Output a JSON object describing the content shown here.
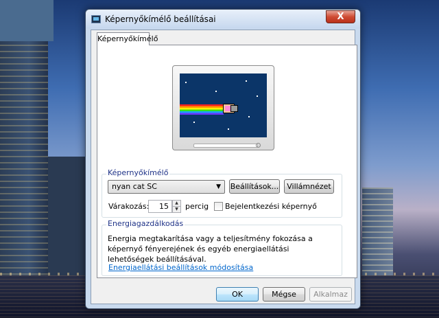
{
  "window": {
    "title": "Képernyőkímélő beállításai",
    "close_glyph": "X"
  },
  "tabs": [
    {
      "label": "Képernyőkímélő",
      "selected": true
    }
  ],
  "screensaver_group": {
    "label": "Képernyőkímélő",
    "selected_saver": "nyan cat SC",
    "settings_button": "Beállítások...",
    "preview_button": "Villámnézet",
    "wait_label": "Várakozás:",
    "wait_value": "15",
    "wait_unit": "percig",
    "logon_checkbox_label": "Bejelentkezési képernyő",
    "logon_checked": false
  },
  "power_group": {
    "label": "Energiagazdálkodás",
    "description": "Energia megtakarítása vagy a teljesítmény fokozása a képernyő fényerejének és egyéb energiaellátási lehetőségek beállításával.",
    "link": "Energiaellátási beállítások módosítása"
  },
  "buttons": {
    "ok": "OK",
    "cancel": "Mégse",
    "apply": "Alkalmaz"
  },
  "colors": {
    "accent": "#1e3287",
    "link": "#0066cc",
    "preview_bg": "#0b3568"
  }
}
